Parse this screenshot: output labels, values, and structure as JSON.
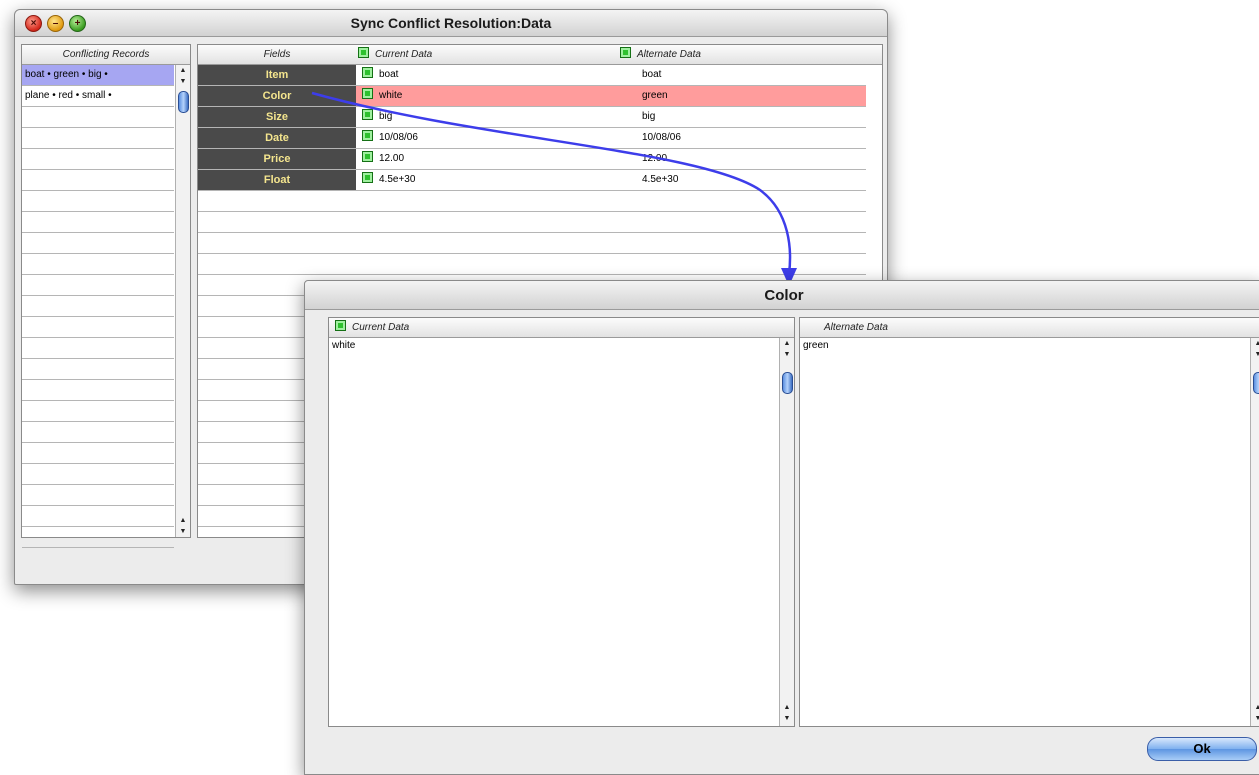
{
  "main_window": {
    "title": "Sync Conflict Resolution:Data",
    "records": {
      "header": "Conflicting Records",
      "items": [
        "boat • green • big •",
        "plane • red • small •"
      ]
    },
    "fields": {
      "headers": {
        "fields": "Fields",
        "current": "Current Data",
        "alternate": "Alternate Data"
      },
      "rows": [
        {
          "name": "Item",
          "current": "boat",
          "alternate": "boat"
        },
        {
          "name": "Color",
          "current": "white",
          "alternate": "green"
        },
        {
          "name": "Size",
          "current": "big",
          "alternate": "big"
        },
        {
          "name": "Date",
          "current": "10/08/06",
          "alternate": "10/08/06"
        },
        {
          "name": "Price",
          "current": "12.00",
          "alternate": "12.00"
        },
        {
          "name": "Float",
          "current": "4.5e+30",
          "alternate": "4.5e+30"
        }
      ]
    }
  },
  "color_dialog": {
    "title": "Color",
    "current_header": "Current Data",
    "alternate_header": "Alternate Data",
    "current_value": "white",
    "alternate_value": "green",
    "ok_label": "Ok"
  },
  "colors": {
    "conflict_row": "#ff9c9c",
    "selected_record": "#a6a6f2",
    "arrow": "#3d3dea"
  }
}
